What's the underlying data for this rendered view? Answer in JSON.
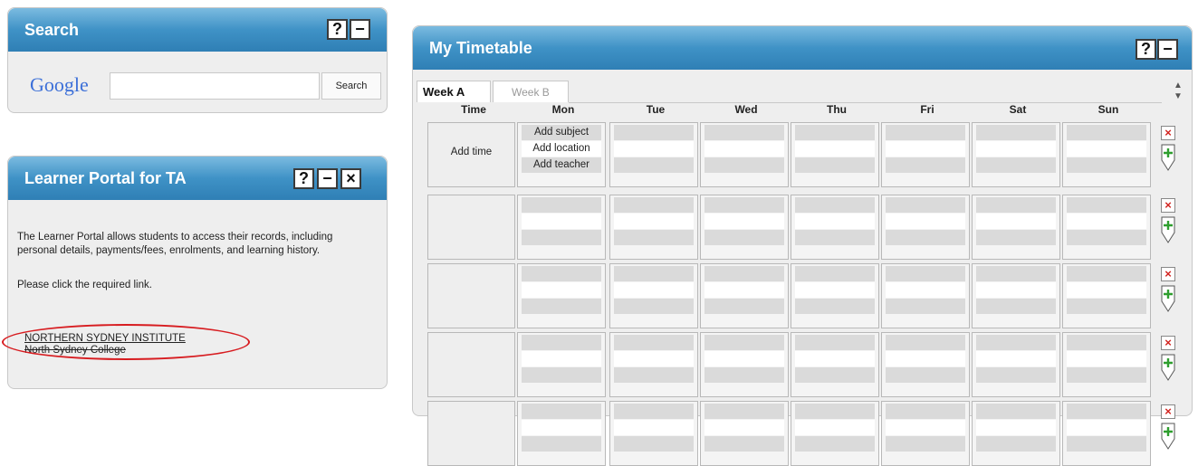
{
  "search_panel": {
    "title": "Search",
    "help": "?",
    "minimize": "−",
    "logo": "Google",
    "input_value": "",
    "button": "Search"
  },
  "learner_panel": {
    "title": "Learner Portal for TA",
    "help": "?",
    "minimize": "−",
    "close": "×",
    "description": "The Learner Portal allows students to access their records, including personal details, payments/fees, enrolments, and learning history.",
    "instruction": "Please click the required link.",
    "links": [
      "NORTHERN SYDNEY INSTITUTE",
      "North Sydney College"
    ]
  },
  "timetable": {
    "title": "My Timetable",
    "help": "?",
    "minimize": "−",
    "tabs": [
      "Week A",
      "Week B"
    ],
    "active_tab": "Week A",
    "columns": [
      "Time",
      "Mon",
      "Tue",
      "Wed",
      "Thu",
      "Fri",
      "Sat",
      "Sun"
    ],
    "first_row": {
      "time": "Add time",
      "mon": [
        "Add subject",
        "Add location",
        "Add teacher"
      ]
    },
    "row_controls": {
      "remove": "×",
      "add": "+"
    },
    "colors": {
      "header_blue": "#3f92c6",
      "remove_red": "#d2231f",
      "add_green": "#2e9e2e",
      "highlight_oval": "#d71c20"
    }
  }
}
